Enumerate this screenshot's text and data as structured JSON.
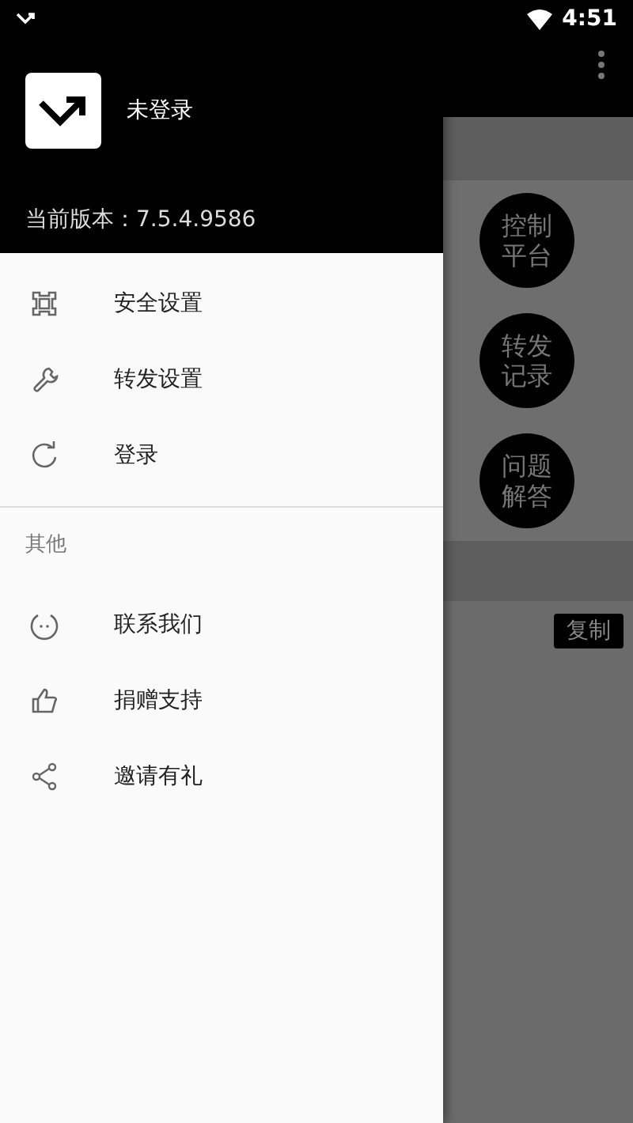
{
  "status_bar": {
    "time": "4:51"
  },
  "drawer": {
    "user": "未登录",
    "version": "当前版本：7.5.4.9586",
    "items": [
      {
        "label": "安全设置",
        "kind": "security"
      },
      {
        "label": "转发设置",
        "kind": "wrench"
      },
      {
        "label": "登录",
        "kind": "refresh"
      }
    ],
    "section": "其他",
    "more_items": [
      {
        "label": "联系我们",
        "kind": "chat"
      },
      {
        "label": "捐赠支持",
        "kind": "thumb"
      },
      {
        "label": "邀请有礼",
        "kind": "share"
      }
    ]
  },
  "main": {
    "actions": [
      "控制平台",
      "转发记录",
      "问题解答"
    ],
    "copy_button": "复制"
  }
}
